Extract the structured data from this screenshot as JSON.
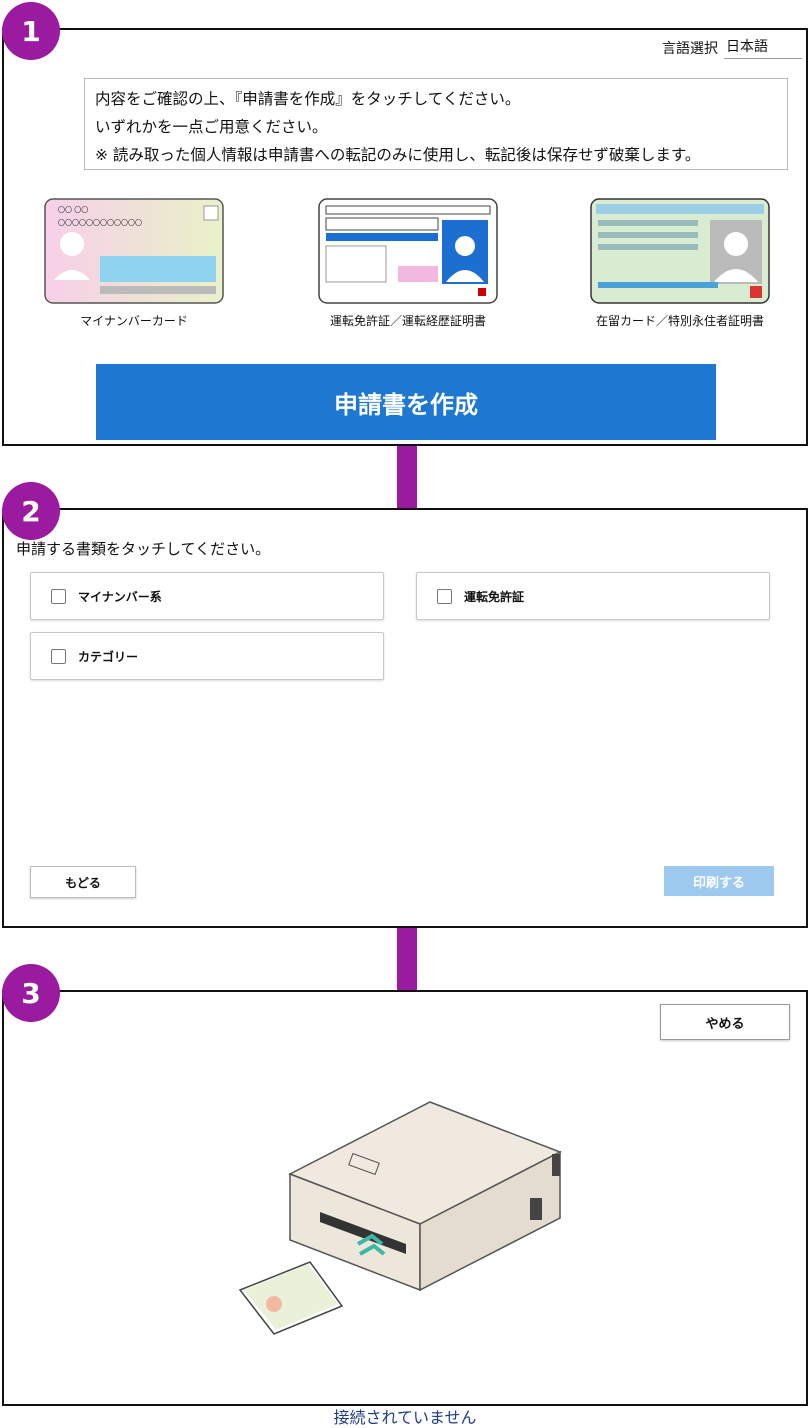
{
  "step1": {
    "badge": "1",
    "language_label": "言語選択",
    "language_value": "日本語",
    "notice_lines": [
      "内容をご確認の上、『申請書を作成』をタッチしてください。",
      "いずれかを一点ご用意ください。",
      "※ 読み取った個人情報は申請書への転記のみに使用し、転記後は保存せず破棄します。"
    ],
    "cards": [
      {
        "caption": "マイナンバーカード",
        "icon": "my-number-card-icon",
        "color": "#f2d6ec"
      },
      {
        "caption": "運転免許証／運転経歴証明書",
        "icon": "drivers-license-icon",
        "color": "#ffffff"
      },
      {
        "caption": "在留カード／特別永住者証明書",
        "icon": "residence-card-icon",
        "color": "#cfe8c6"
      }
    ],
    "create_button": "申請書を作成",
    "accent": "#1e78d2"
  },
  "step2": {
    "badge": "2",
    "title": "申請する書類をタッチしてください。",
    "options": [
      "マイナンバー系",
      "運転免許証",
      "カテゴリー"
    ],
    "back_button": "もどる",
    "print_button": "印刷する"
  },
  "step3": {
    "badge": "3",
    "cancel_button": "やめる",
    "status": "接続されていません",
    "status_color": "#1f3d86"
  },
  "badge_color": "#9a1b9f"
}
